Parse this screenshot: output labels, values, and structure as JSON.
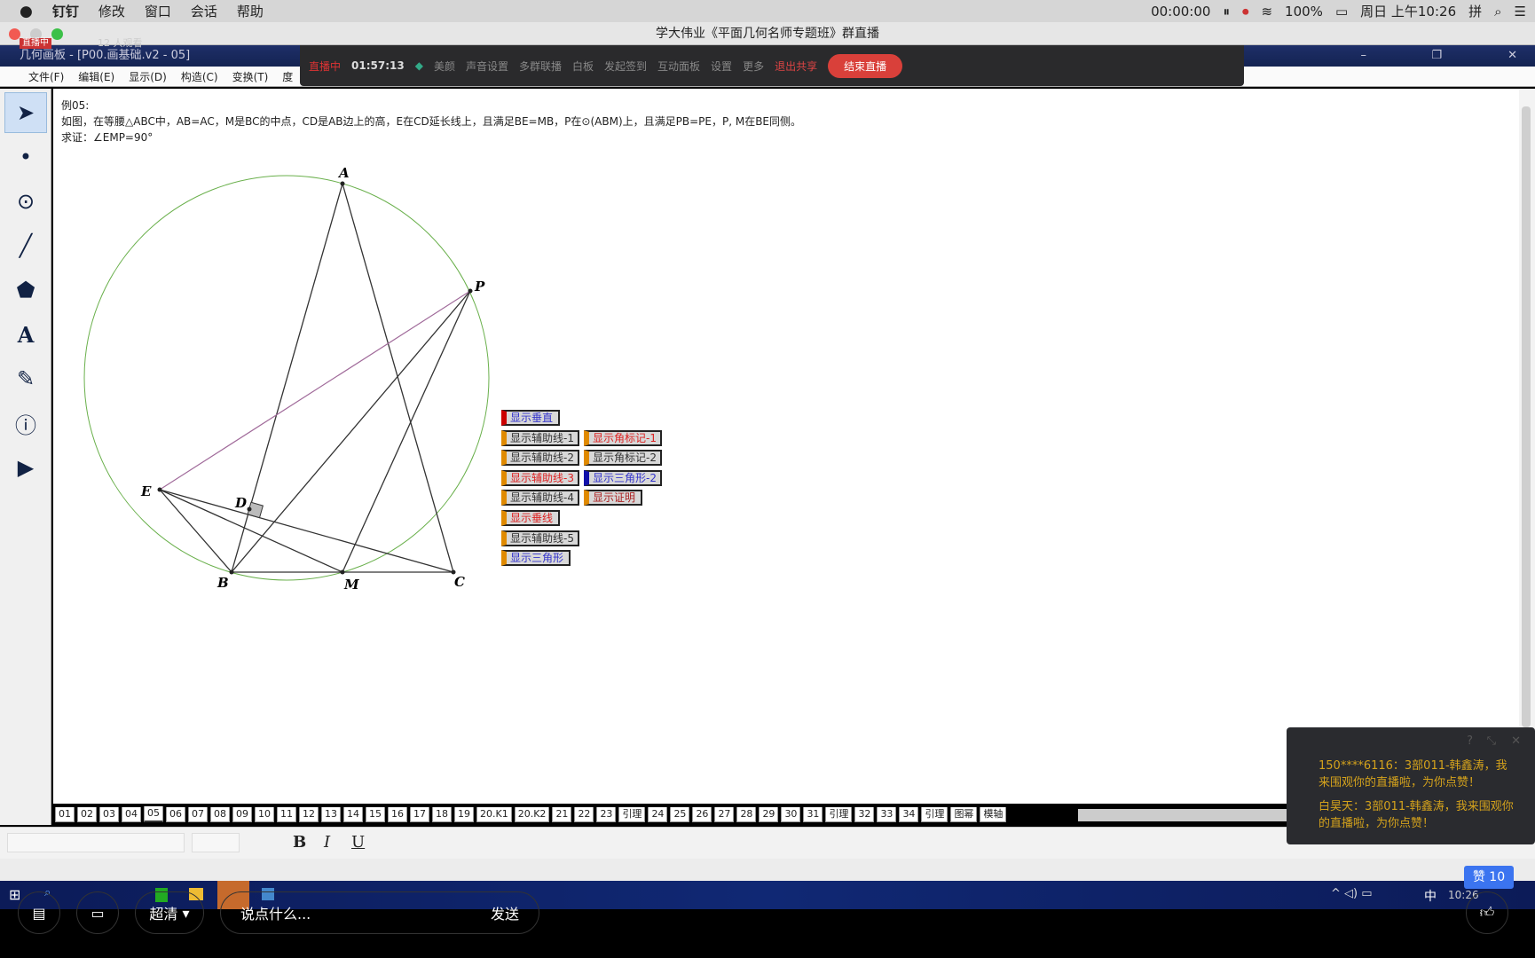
{
  "mac_menu": {
    "apple": "",
    "items": [
      "钉钉",
      "修改",
      "窗口",
      "会话",
      "帮助"
    ],
    "record_time": "00:00:00",
    "battery": "100%",
    "datetime": "周日 上午10:26",
    "ime": "拼"
  },
  "window": {
    "title": "学大伟业《平面几何名师专题班》群直播",
    "viewer_badge": "直播中",
    "viewers": "12 人观看"
  },
  "app": {
    "title": "几何画板 - [P00.画基础.v2 - 05]",
    "menu": [
      "文件(F)",
      "编辑(E)",
      "显示(D)",
      "构造(C)",
      "变换(T)",
      "度"
    ]
  },
  "live_toolbar": {
    "status": "直播中",
    "elapsed": "01:57:13",
    "items": [
      "美颜",
      "声音设置",
      "多群联播",
      "白板",
      "发起签到",
      "互动面板",
      "设置",
      "更多"
    ],
    "stop_share": "退出共享",
    "end_live": "结束直播"
  },
  "problem": {
    "title": "例05:",
    "statement": "如图，在等腰△ABC中，AB=AC，M是BC的中点，CD是AB边上的高，E在CD延长线上，且满足BE=MB，P在⊙(ABM)上，且满足PB=PE，P, M在BE同侧。",
    "prove": "求证：∠EMP=90°"
  },
  "figure": {
    "points": [
      "A",
      "P",
      "E",
      "D",
      "B",
      "M",
      "C"
    ]
  },
  "buttons": [
    {
      "label": "显示垂直",
      "color": "#3333cc",
      "bar": "#cc0000"
    },
    {
      "label": "显示辅助线-1",
      "color": "#333333",
      "bar": "#e08a00"
    },
    {
      "label": "显示角标记-1",
      "color": "#dd2222",
      "bar": "#e08a00"
    },
    {
      "label": "显示辅助线-2",
      "color": "#333333",
      "bar": "#e08a00"
    },
    {
      "label": "显示角标记-2",
      "color": "#333333",
      "bar": "#e08a00"
    },
    {
      "label": "显示辅助线-3",
      "color": "#dd2222",
      "bar": "#e08a00"
    },
    {
      "label": "显示三角形-2",
      "color": "#3333cc",
      "bar": "#1111aa"
    },
    {
      "label": "显示辅助线-4",
      "color": "#333333",
      "bar": "#e08a00"
    },
    {
      "label": "显示证明",
      "color": "#aa2222",
      "bar": "#e08a00"
    },
    {
      "label": "显示垂线",
      "color": "#dd2222",
      "bar": "#e08a00"
    },
    {
      "label": "显示辅助线-5",
      "color": "#333333",
      "bar": "#e08a00"
    },
    {
      "label": "显示三角形",
      "color": "#3333cc",
      "bar": "#e08a00"
    }
  ],
  "page_tabs": [
    "01",
    "02",
    "03",
    "04",
    "05",
    "06",
    "07",
    "08",
    "09",
    "10",
    "11",
    "12",
    "13",
    "14",
    "15",
    "16",
    "17",
    "18",
    "19",
    "20.K1",
    "20.K2",
    "21",
    "22",
    "23",
    "引理",
    "24",
    "25",
    "26",
    "27",
    "28",
    "29",
    "30",
    "31",
    "引理",
    "32",
    "33",
    "34",
    "引理",
    "图幂",
    "模轴"
  ],
  "current_tab": "05",
  "format_bar": {
    "bold": "B",
    "italic": "I",
    "underline": "U"
  },
  "taskbar": {
    "ime": "中",
    "time": "10:26"
  },
  "bottom": {
    "quality": "超清",
    "input_placeholder": "说点什么...",
    "send": "发送",
    "likes": "赞 10"
  },
  "chat": [
    {
      "text": "150****6116：3部011-韩鑫涛，我来围观你的直播啦，为你点赞！"
    },
    {
      "text": "白昊天：3部011-韩鑫涛，我来围观你的直播啦，为你点赞！"
    }
  ]
}
